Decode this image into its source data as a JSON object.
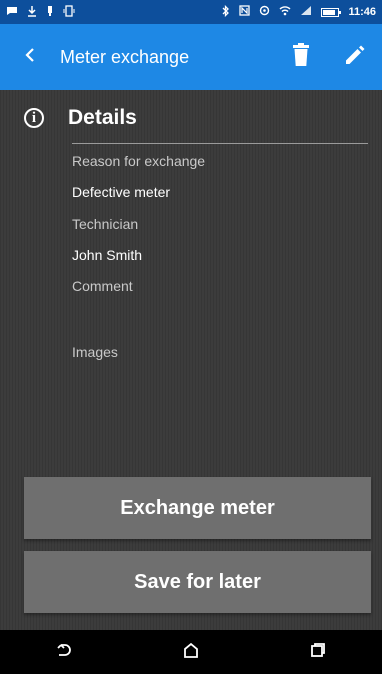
{
  "status_bar": {
    "time": "11:46",
    "battery_level": 0.8,
    "icons": [
      "notification-icon",
      "download-icon",
      "usb-icon",
      "vibrate-icon",
      "bluetooth-icon",
      "nfc-icon",
      "sync-icon",
      "wifi-icon",
      "signal-icon",
      "battery-icon"
    ]
  },
  "app_bar": {
    "title": "Meter exchange",
    "color": "#1e88e5",
    "actions": [
      "back-icon",
      "delete-icon",
      "edit-icon"
    ]
  },
  "details": {
    "title": "Details",
    "fields": [
      {
        "label": "Reason for exchange",
        "value": "Defective meter"
      },
      {
        "label": "Technician",
        "value": "John Smith"
      },
      {
        "label": "Comment",
        "value": ""
      },
      {
        "label": "Images",
        "value": ""
      }
    ]
  },
  "buttons": {
    "exchange": "Exchange meter",
    "save": "Save for later"
  },
  "nav": [
    "back-nav-icon",
    "home-nav-icon",
    "recents-nav-icon"
  ]
}
